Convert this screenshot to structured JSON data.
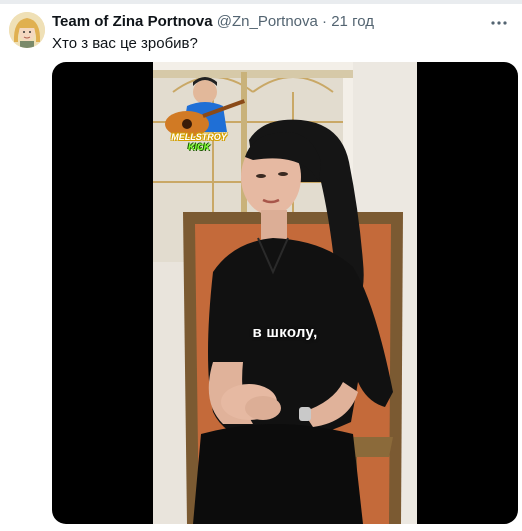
{
  "tweet": {
    "author": {
      "display_name": "Team of Zina Portnova",
      "handle": "@Zn_Portnova",
      "separator": "·",
      "time": "21 год"
    },
    "text": "Хто з вас це зробив?",
    "more_icon": "ellipsis-icon",
    "media": {
      "type": "video",
      "caption": "в школу,",
      "sticker": {
        "line1": "MELLSTROY",
        "line2": "KICK"
      }
    }
  },
  "colors": {
    "name": "#0f1419",
    "secondary": "#536471",
    "media_background": "#000000"
  }
}
